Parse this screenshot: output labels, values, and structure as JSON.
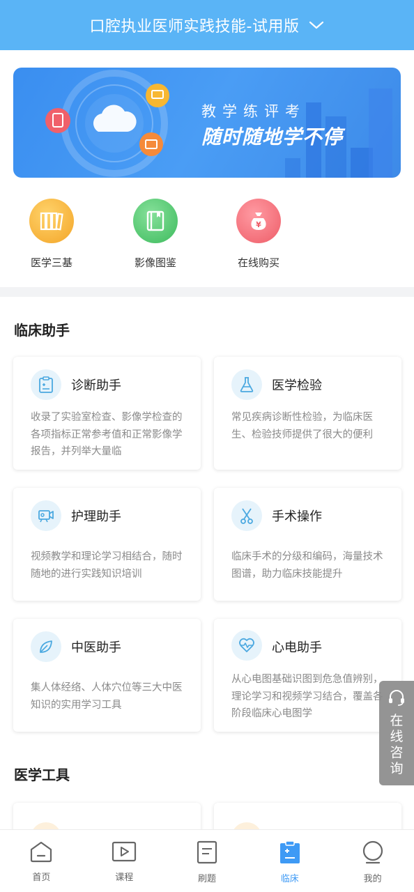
{
  "header": {
    "title": "口腔执业医师实践技能-试用版"
  },
  "banner": {
    "subtitle": "教学练评考",
    "headline": "随时随地学不停"
  },
  "quick_entries": [
    {
      "label": "医学三基",
      "icon": "books-icon",
      "color": "#f6b53a"
    },
    {
      "label": "影像图鉴",
      "icon": "album-icon",
      "color": "#4ec46d"
    },
    {
      "label": "在线购买",
      "icon": "money-bag-icon",
      "color": "#f0656e"
    }
  ],
  "clinical": {
    "title": "临床助手",
    "cards": [
      {
        "title": "诊断助手",
        "icon": "clipboard-icon",
        "desc": "收录了实验室检查、影像学检查的各项指标正常参考值和正常影像学报告，并列举大量临"
      },
      {
        "title": "医学检验",
        "icon": "flask-icon",
        "desc": "常见疾病诊断性检验，为临床医生、检验技师提供了很大的便利"
      },
      {
        "title": "护理助手",
        "icon": "video-camera-icon",
        "desc": "视频教学和理论学习相结合，随时随地的进行实践知识培训"
      },
      {
        "title": "手术操作",
        "icon": "scissors-icon",
        "desc": "临床手术的分级和编码，海量技术图谱，助力临床技能提升"
      },
      {
        "title": "中医助手",
        "icon": "leaf-icon",
        "desc": "集人体经络、人体穴位等三大中医知识的实用学习工具"
      },
      {
        "title": "心电助手",
        "icon": "heartbeat-icon",
        "desc": "从心电图基础识图到危急值辨别，理论学习和视频学习结合，覆盖各阶段临床心电图学"
      }
    ]
  },
  "tools": {
    "title": "医学工具"
  },
  "consult": {
    "label": "在线咨询"
  },
  "tabbar": {
    "items": [
      {
        "label": "首页",
        "icon": "home-icon",
        "active": false
      },
      {
        "label": "课程",
        "icon": "play-icon",
        "active": false
      },
      {
        "label": "刷题",
        "icon": "document-icon",
        "active": false
      },
      {
        "label": "临床",
        "icon": "clinical-clipboard-icon",
        "active": true
      },
      {
        "label": "我的",
        "icon": "profile-icon",
        "active": false
      }
    ]
  },
  "colors": {
    "primary": "#5ab4f6",
    "active_tab": "#3e9af5",
    "accent_light": "#e6f3fb"
  }
}
